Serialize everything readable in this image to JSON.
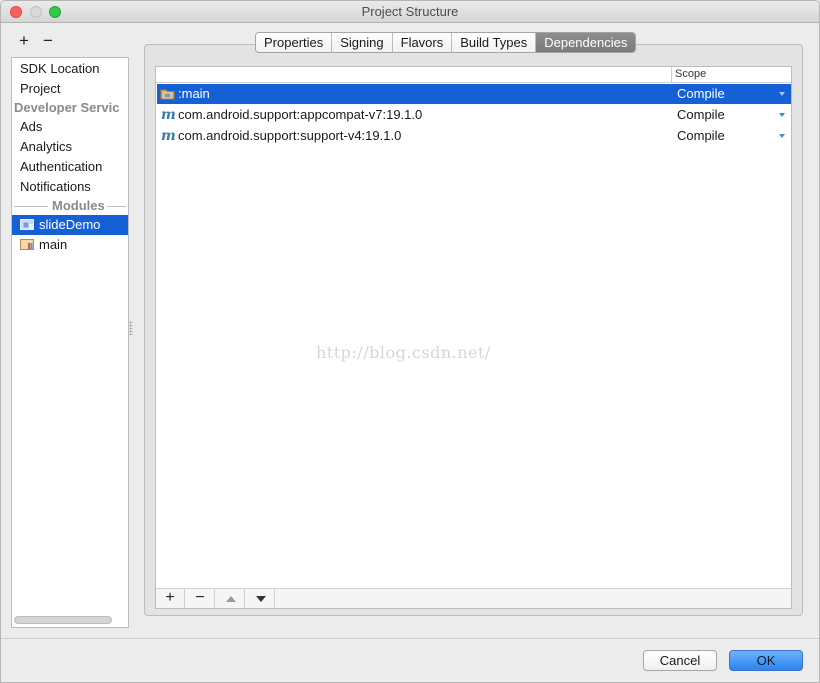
{
  "window": {
    "title": "Project Structure"
  },
  "sidebar_tools": {
    "add": "+",
    "remove": "−"
  },
  "sidebar": {
    "items": [
      {
        "label": "SDK Location"
      },
      {
        "label": "Project"
      },
      {
        "label": "Developer Servic",
        "header": true
      },
      {
        "label": "Ads"
      },
      {
        "label": "Analytics"
      },
      {
        "label": "Authentication"
      },
      {
        "label": "Notifications"
      }
    ],
    "modules_label": "Modules",
    "modules": [
      {
        "label": "slideDemo",
        "selected": true
      },
      {
        "label": "main"
      }
    ]
  },
  "tabs": [
    {
      "label": "Properties"
    },
    {
      "label": "Signing"
    },
    {
      "label": "Flavors"
    },
    {
      "label": "Build Types"
    },
    {
      "label": "Dependencies",
      "active": true
    }
  ],
  "table": {
    "scope_header": "Scope",
    "rows": [
      {
        "name": ":main",
        "scope": "Compile",
        "icon": "module-folder-icon",
        "selected": true
      },
      {
        "name": "com.android.support:appcompat-v7:19.1.0",
        "scope": "Compile",
        "icon": "maven-icon"
      },
      {
        "name": "com.android.support:support-v4:19.1.0",
        "scope": "Compile",
        "icon": "maven-icon"
      }
    ],
    "tools": {
      "add": "+",
      "remove": "−"
    }
  },
  "watermark": "http://blog.csdn.net/",
  "buttons": {
    "cancel": "Cancel",
    "ok": "OK"
  },
  "colors": {
    "selection": "#1560d4",
    "ok_button": "#2a84f0"
  }
}
